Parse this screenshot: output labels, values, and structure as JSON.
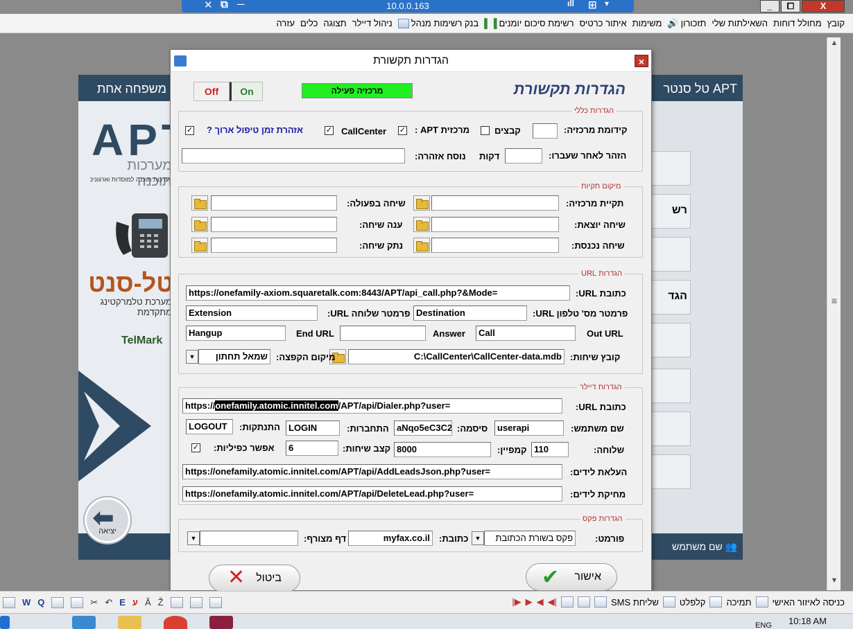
{
  "remote": {
    "host": "10.0.0.163",
    "icons": [
      "✕",
      "⧉",
      "─",
      "ıll",
      "⊞",
      "▾"
    ]
  },
  "window_buttons": {
    "minimize": "_",
    "restore": "⧠",
    "close": "X"
  },
  "menubar": {
    "items": [
      "קובץ",
      "מחולל דוחות",
      "השאילתות שלי",
      "תזכורון",
      "משימות",
      "איתור כרטיס",
      "רשימת סיכום יומנים",
      "בנק רשימות מנהל",
      "ניהול דיילר",
      "תצוגה",
      "כלים",
      "עזרה"
    ]
  },
  "bg_app": {
    "title_left": "משפחה אחת",
    "title_right": "APT טל סנטר",
    "apt_logo": "APT",
    "apt_sub": "מערכות תוכנה",
    "apt_sub2": "מערכות תוכנה למוסדות וארגונים",
    "brand": "טל-סנטר",
    "brand_sub": "מערכת טלמרקטינג מתקדמת",
    "telmark": "TelMark",
    "side_btn_1": "רש",
    "side_btn_2": "הגד",
    "bottom_right": "שם משתמש",
    "exit_label": "יציאה"
  },
  "dialog": {
    "title": "הגדרות תקשורת",
    "heading": "הגדרות תקשורת",
    "close": "×",
    "toggle_off": "Off",
    "toggle_on": "On",
    "status": "מרכזיה פעילה",
    "general": {
      "legend": "הגדרות כללי",
      "prefix_label": "קידומת מרכזיה:",
      "prefix_value": "",
      "files_label": "קבצים",
      "files_checked": false,
      "apt_label": "מרכזית APT :",
      "apt_checked": true,
      "callcenter_label": "CallCenter",
      "callcenter_checked": true,
      "longcall_label": "אזהרת זמן טיפול ארוך ?",
      "longcall_checked": true,
      "warn_after_label": "הזהר לאחר שעברו:",
      "warn_after_value": "",
      "minutes_label": "דקות",
      "warn_text_label": "נוסח אזהרה:",
      "warn_text_value": ""
    },
    "folders": {
      "legend": "מיקום תקיות",
      "pbx_folder_label": "תקיית מרכזיה:",
      "pbx_folder_value": "",
      "active_call_label": "שיחה בפעולה:",
      "active_call_value": "",
      "outgoing_label": "שיחה יוצאת:",
      "outgoing_value": "",
      "answered_label": "ענה שיחה:",
      "answered_value": "",
      "incoming_label": "שיחה נכנסת:",
      "incoming_value": "",
      "hangup_label": "נתק שיחה:",
      "hangup_value": ""
    },
    "url": {
      "legend": "הגדרות URL",
      "address_label": "כתובת URL:",
      "address_value": "https://onefamily-axiom.squaretalk.com:8443/APT/api_call.php?&Mode=",
      "phone_param_label": "פרמטר מס' טלפון URL:",
      "phone_param_value": "Destination",
      "ext_param_label": "פרמטר שלוחה URL:",
      "ext_param_value": "Extension",
      "out_url_label": "Out URL",
      "out_url_value": "Call",
      "answer_label": "Answer",
      "answer_value": "",
      "end_url_label": "End URL",
      "end_url_value": "Hangup",
      "calls_file_label": "קובץ שיחות:",
      "calls_file_value": "C:\\CallCenter\\CallCenter-data.mdb",
      "popup_pos_label": "מיקום הקפצה:",
      "popup_pos_value": "שמאל תחתון"
    },
    "dialer": {
      "legend": "הגדרות דיילר",
      "address_label": "כתובת URL:",
      "address_prefix": "https://",
      "address_highlight": "onefamily.atomic.innitel.com",
      "address_suffix": "/APT/api/Dialer.php?user=",
      "user_label": "שם משתמש:",
      "user_value": "userapi",
      "password_label": "סיסמה:",
      "password_value": "aNqo5eC3C2",
      "login_label": "התחברות:",
      "login_value": "LOGIN",
      "logout_label": "התנתקות:",
      "logout_value": "LOGOUT",
      "ext_label": "שלוחה:",
      "ext_value": "110",
      "campaign_label": "קמפיין:",
      "campaign_value": "8000",
      "rate_label": "קצב שיחות:",
      "rate_value": "6",
      "dup_label": "אפשר כפיליות:",
      "dup_checked": true,
      "upload_label": "העלאת לידים:",
      "upload_value": "https://onefamily.atomic.innitel.com/APT/api/AddLeadsJson.php?user=",
      "delete_label": "מחיקת לידים:",
      "delete_value": "https://onefamily.atomic.innitel.com/APT/api/DeleteLead.php?user="
    },
    "fax": {
      "legend": "הגדרות פקס",
      "format_label": "פורמט:",
      "format_value": "פקס בשורת הכתובת",
      "address_label": "כתובת:",
      "address_value": "myfax.co.il",
      "page_label": "דף מצורף:",
      "page_value": ""
    },
    "ok_label": "אישור",
    "cancel_label": "ביטול"
  },
  "toolbar2": {
    "items": [
      "כניסה לאיזור האישי",
      "תמיכה",
      "קלפלט",
      "שליחת SMS"
    ],
    "left_glyphs": [
      "W",
      "Q",
      "E",
      "ע",
      "Ă",
      "Ž"
    ]
  },
  "taskbar": {
    "time": "10:18 AM",
    "lang": "ENG"
  },
  "colors": {
    "accent": "#2f4a63",
    "status_green": "#22ee22",
    "remote_bar": "#2a72c8"
  }
}
